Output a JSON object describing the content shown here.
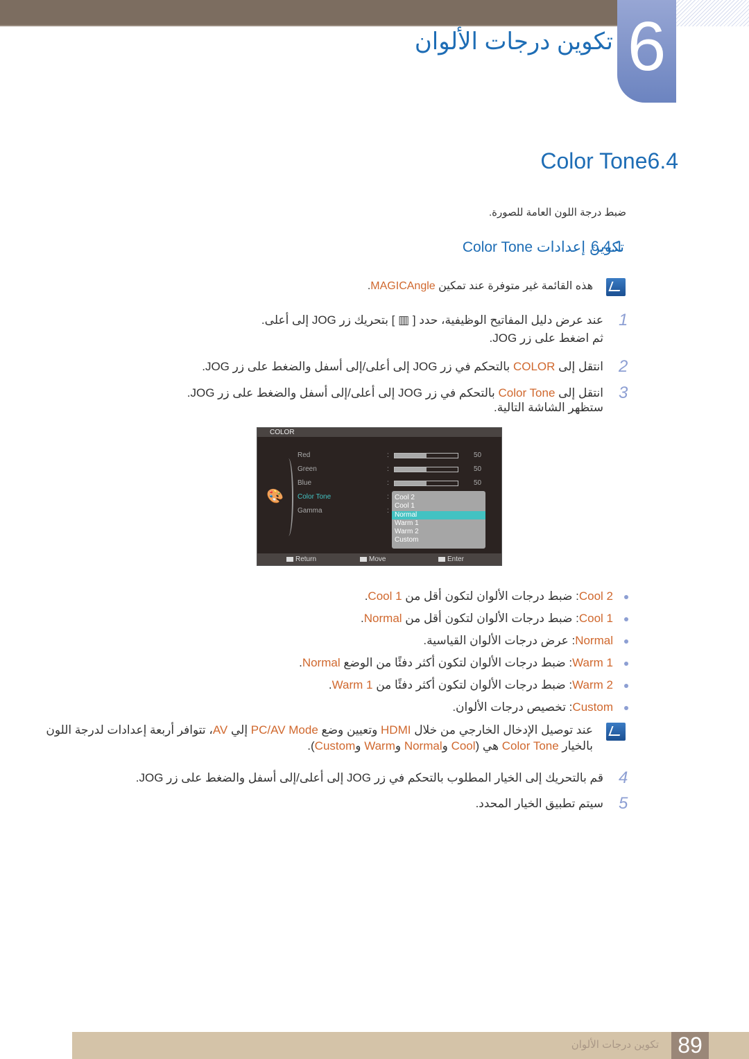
{
  "header": {
    "chapter_number": "6",
    "chapter_title": "تكوين درجات الألوان"
  },
  "section": {
    "number": "6.4",
    "title": "Color Tone"
  },
  "intro": "ضبط درجة اللون العامة للصورة.",
  "subsection": {
    "number": "6.4.1",
    "title": "تكوين إعدادات Color Tone"
  },
  "note1": [
    {
      "t": "هذه القائمة غير متوفرة عند تمكين "
    },
    {
      "t": "MAGICAngle",
      "c": "o"
    },
    {
      "t": "."
    }
  ],
  "steps": [
    {
      "n": "1",
      "lines": [
        [
          {
            "t": "عند عرض دليل المفاتيح الوظيفية، حدد [ ▥ ] بتحريك زر JOG إلى أعلى."
          }
        ],
        [
          {
            "t": "ثم اضغط على زر JOG."
          }
        ]
      ]
    },
    {
      "n": "2",
      "lines": [
        [
          {
            "t": "انتقل إلى "
          },
          {
            "t": "COLOR",
            "c": "o"
          },
          {
            "t": " بالتحكم في زر JOG إلى أعلى/إلى أسفل والضغط على زر JOG."
          }
        ]
      ]
    },
    {
      "n": "3",
      "lines": [
        [
          {
            "t": "انتقل إلى "
          },
          {
            "t": "Color Tone",
            "c": "o"
          },
          {
            "t": " بالتحكم في زر JOG إلى أعلى/إلى أسفل والضغط على زر JOG."
          }
        ],
        [
          {
            "t": "ستظهر الشاشة التالية."
          }
        ]
      ]
    },
    {
      "n": "4",
      "lines": [
        [
          {
            "t": "قم بالتحريك إلى الخيار المطلوب بالتحكم في زر JOG إلى أعلى/إلى أسفل والضغط على زر JOG."
          }
        ]
      ]
    },
    {
      "n": "5",
      "lines": [
        [
          {
            "t": "سيتم تطبيق الخيار المحدد."
          }
        ]
      ]
    }
  ],
  "osd": {
    "title": "COLOR",
    "items": [
      {
        "label": "Red",
        "value": "50",
        "level": 50
      },
      {
        "label": "Green",
        "value": "50",
        "level": 50
      },
      {
        "label": "Blue",
        "value": "50",
        "level": 50
      },
      {
        "label": "Color Tone"
      },
      {
        "label": "Gamma"
      }
    ],
    "options": [
      "Cool 2",
      "Cool 1",
      "Normal",
      "Warm 1",
      "Warm 2",
      "Custom"
    ],
    "selected": "Normal",
    "footer": {
      "return": "Return",
      "move": "Move",
      "enter": "Enter"
    },
    "highlight_color": "#43c2c2"
  },
  "bullets": [
    [
      {
        "t": "Cool 2",
        "c": "o"
      },
      {
        "t": ": ضبط درجات الألوان لتكون أقل من "
      },
      {
        "t": "Cool 1",
        "c": "o"
      },
      {
        "t": "."
      }
    ],
    [
      {
        "t": "Cool 1",
        "c": "o"
      },
      {
        "t": ": ضبط درجات الألوان لتكون أقل من "
      },
      {
        "t": "Normal",
        "c": "o"
      },
      {
        "t": "."
      }
    ],
    [
      {
        "t": "Normal",
        "c": "o"
      },
      {
        "t": ": عرض درجات الألوان القياسية."
      }
    ],
    [
      {
        "t": "Warm 1",
        "c": "o"
      },
      {
        "t": ": ضبط درجات الألوان لتكون أكثر دفئًا من الوضع "
      },
      {
        "t": "Normal",
        "c": "o"
      },
      {
        "t": "."
      }
    ],
    [
      {
        "t": "Warm 2",
        "c": "o"
      },
      {
        "t": ": ضبط درجات الألوان لتكون أكثر دفئًا من "
      },
      {
        "t": "Warm 1",
        "c": "o"
      },
      {
        "t": "."
      }
    ],
    [
      {
        "t": "Custom",
        "c": "o"
      },
      {
        "t": ": تخصيص درجات الألوان."
      }
    ]
  ],
  "note2": [
    [
      {
        "t": "عند توصيل الإدخال الخارجي من خلال "
      },
      {
        "t": "HDMI",
        "c": "o"
      },
      {
        "t": " وتعيين وضع "
      },
      {
        "t": "PC/AV Mode",
        "c": "o"
      },
      {
        "t": " إلي "
      },
      {
        "t": "AV",
        "c": "o"
      },
      {
        "t": "، تتوافر أربعة إعدادات لدرجة اللون"
      }
    ],
    [
      {
        "t": "بالخيار "
      },
      {
        "t": "Color Tone",
        "c": "o"
      },
      {
        "t": " هي ("
      },
      {
        "t": "Cool",
        "c": "o"
      },
      {
        "t": " و"
      },
      {
        "t": "Normal",
        "c": "o"
      },
      {
        "t": " و"
      },
      {
        "t": "Warm",
        "c": "o"
      },
      {
        "t": " و"
      },
      {
        "t": "Custom",
        "c": "o"
      },
      {
        "t": ")."
      }
    ]
  ],
  "footer": {
    "page": "89",
    "title": "تكوين درجات الألوان"
  },
  "colors": {
    "title_blue": "#1e6db5",
    "accent_orange": "#d0682e",
    "step_number": "#8d9fd3"
  }
}
